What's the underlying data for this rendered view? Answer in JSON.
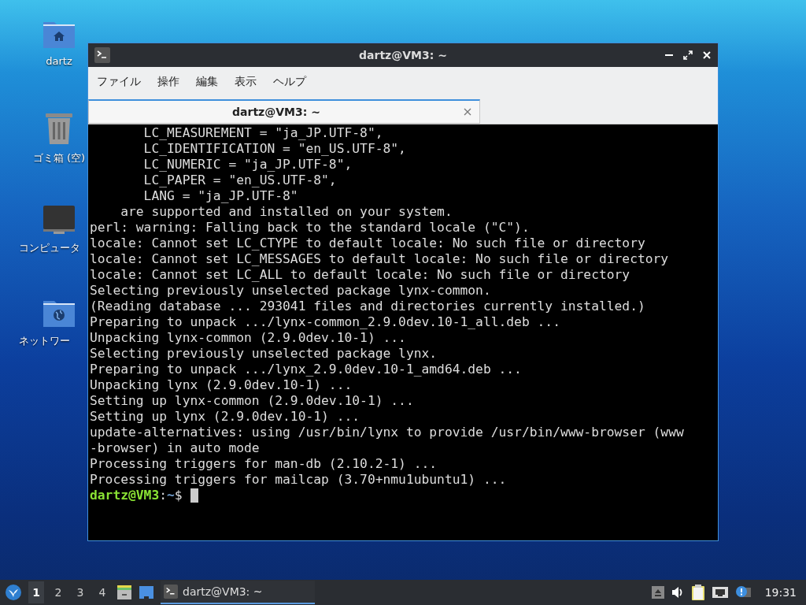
{
  "desktop_icons": [
    {
      "kind": "home",
      "label": "dartz"
    },
    {
      "kind": "trash",
      "label": "ゴミ箱 (空)"
    },
    {
      "kind": "computer",
      "label": "コンピュータ"
    },
    {
      "kind": "network",
      "label": "ネットワー"
    }
  ],
  "window": {
    "title": "dartz@VM3: ~",
    "menu": [
      "ファイル",
      "操作",
      "編集",
      "表示",
      "ヘルプ"
    ],
    "tabs": [
      {
        "label": "dartz@VM3: ~",
        "selected": true
      }
    ],
    "terminal": {
      "lines": [
        "       LC_MEASUREMENT = \"ja_JP.UTF-8\",",
        "       LC_IDENTIFICATION = \"en_US.UTF-8\",",
        "       LC_NUMERIC = \"ja_JP.UTF-8\",",
        "       LC_PAPER = \"en_US.UTF-8\",",
        "       LANG = \"ja_JP.UTF-8\"",
        "    are supported and installed on your system.",
        "perl: warning: Falling back to the standard locale (\"C\").",
        "locale: Cannot set LC_CTYPE to default locale: No such file or directory",
        "locale: Cannot set LC_MESSAGES to default locale: No such file or directory",
        "locale: Cannot set LC_ALL to default locale: No such file or directory",
        "Selecting previously unselected package lynx-common.",
        "(Reading database ... 293041 files and directories currently installed.)",
        "Preparing to unpack .../lynx-common_2.9.0dev.10-1_all.deb ...",
        "Unpacking lynx-common (2.9.0dev.10-1) ...",
        "Selecting previously unselected package lynx.",
        "Preparing to unpack .../lynx_2.9.0dev.10-1_amd64.deb ...",
        "Unpacking lynx (2.9.0dev.10-1) ...",
        "Setting up lynx-common (2.9.0dev.10-1) ...",
        "Setting up lynx (2.9.0dev.10-1) ...",
        "update-alternatives: using /usr/bin/lynx to provide /usr/bin/www-browser (www",
        "-browser) in auto mode",
        "Processing triggers for man-db (2.10.2-1) ...",
        "Processing triggers for mailcap (3.70+nmu1ubuntu1) ..."
      ],
      "prompt": {
        "user": "dartz@VM3",
        "separator": ":",
        "path": "~",
        "symbol": "$"
      }
    }
  },
  "taskbar": {
    "workspaces": [
      {
        "label": "1",
        "selected": true
      },
      {
        "label": "2",
        "selected": false
      },
      {
        "label": "3",
        "selected": false
      },
      {
        "label": "4",
        "selected": false
      }
    ],
    "tasks": [
      {
        "label": "dartz@VM3: ~",
        "selected": true
      }
    ],
    "clock": "19:31"
  }
}
